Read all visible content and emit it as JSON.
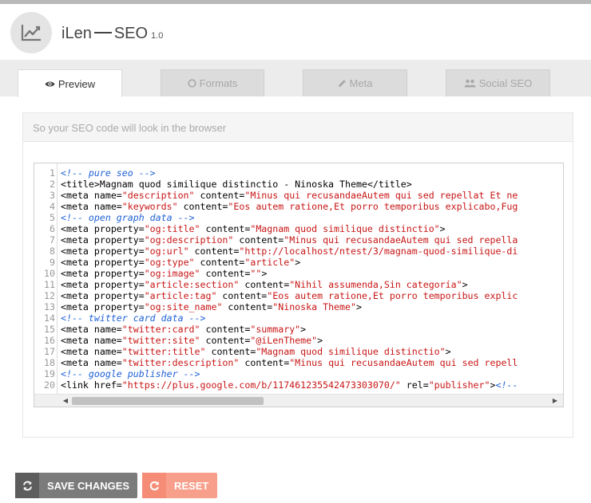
{
  "app": {
    "logo_icon": "trend-chart-icon",
    "name_part1": "iLen",
    "name_part2": "SEO",
    "version": "1.0"
  },
  "tabs": [
    {
      "label": "Preview",
      "icon": "eye-icon",
      "active": true
    },
    {
      "label": "Formats",
      "icon": "circle-icon",
      "active": false
    },
    {
      "label": "Meta",
      "icon": "pencil-icon",
      "active": false
    },
    {
      "label": "Social SEO",
      "icon": "users-icon",
      "active": false
    }
  ],
  "panel": {
    "heading": "So your SEO code will look in the browser"
  },
  "code": [
    {
      "n": "1",
      "parts": [
        [
          "cm",
          "<!-- pure seo -->"
        ]
      ]
    },
    {
      "n": "2",
      "parts": [
        [
          "tg",
          "<title>Magnam quod similique distinctio - Ninoska Theme</title>"
        ]
      ]
    },
    {
      "n": "3",
      "parts": [
        [
          "tg",
          "<meta name="
        ],
        [
          "str",
          "\"description\""
        ],
        [
          "tg",
          " content="
        ],
        [
          "str",
          "\"Minus qui recusandaeAutem qui sed repellat Et ne"
        ]
      ]
    },
    {
      "n": "4",
      "parts": [
        [
          "tg",
          "<meta name="
        ],
        [
          "str",
          "\"keywords\""
        ],
        [
          "tg",
          " content="
        ],
        [
          "str",
          "\"Eos autem ratione,Et porro temporibus explicabo,Fug"
        ]
      ]
    },
    {
      "n": "5",
      "parts": [
        [
          "cm",
          "<!-- open graph data -->"
        ]
      ]
    },
    {
      "n": "6",
      "parts": [
        [
          "tg",
          "<meta property="
        ],
        [
          "str",
          "\"og:title\""
        ],
        [
          "tg",
          " content="
        ],
        [
          "str",
          "\"Magnam quod similique distinctio\""
        ],
        [
          "tg",
          ">"
        ]
      ]
    },
    {
      "n": "7",
      "parts": [
        [
          "tg",
          "<meta property="
        ],
        [
          "str",
          "\"og:description\""
        ],
        [
          "tg",
          " content="
        ],
        [
          "str",
          "\"Minus qui recusandaeAutem qui sed repella"
        ]
      ]
    },
    {
      "n": "8",
      "parts": [
        [
          "tg",
          "<meta property="
        ],
        [
          "str",
          "\"og:url\""
        ],
        [
          "tg",
          " content="
        ],
        [
          "str",
          "\"http://localhost/ntest/3/magnam-quod-similique-di"
        ]
      ]
    },
    {
      "n": "9",
      "parts": [
        [
          "tg",
          "<meta property="
        ],
        [
          "str",
          "\"og:type\""
        ],
        [
          "tg",
          " content="
        ],
        [
          "str",
          "\"article\""
        ],
        [
          "tg",
          ">"
        ]
      ]
    },
    {
      "n": "10",
      "parts": [
        [
          "tg",
          "<meta property="
        ],
        [
          "str",
          "\"og:image\""
        ],
        [
          "tg",
          " content="
        ],
        [
          "str",
          "\"\""
        ],
        [
          "tg",
          ">"
        ]
      ]
    },
    {
      "n": "11",
      "parts": [
        [
          "tg",
          "<meta property="
        ],
        [
          "str",
          "\"article:section\""
        ],
        [
          "tg",
          " content="
        ],
        [
          "str",
          "\"Nihil assumenda,Sin categoría\""
        ],
        [
          "tg",
          ">"
        ]
      ]
    },
    {
      "n": "12",
      "parts": [
        [
          "tg",
          "<meta property="
        ],
        [
          "str",
          "\"article:tag\""
        ],
        [
          "tg",
          " content="
        ],
        [
          "str",
          "\"Eos autem ratione,Et porro temporibus explic"
        ]
      ]
    },
    {
      "n": "13",
      "parts": [
        [
          "tg",
          "<meta property="
        ],
        [
          "str",
          "\"og:site_name\""
        ],
        [
          "tg",
          " content="
        ],
        [
          "str",
          "\"Ninoska Theme\""
        ],
        [
          "tg",
          ">"
        ]
      ]
    },
    {
      "n": "14",
      "parts": [
        [
          "cm",
          "<!-- twitter card data -->"
        ]
      ]
    },
    {
      "n": "15",
      "parts": [
        [
          "tg",
          "<meta name="
        ],
        [
          "str",
          "\"twitter:card\""
        ],
        [
          "tg",
          " content="
        ],
        [
          "str",
          "\"summary\""
        ],
        [
          "tg",
          ">"
        ]
      ]
    },
    {
      "n": "16",
      "parts": [
        [
          "tg",
          "<meta name="
        ],
        [
          "str",
          "\"twitter:site\""
        ],
        [
          "tg",
          " content="
        ],
        [
          "str",
          "\"@iLenTheme\""
        ],
        [
          "tg",
          ">"
        ]
      ]
    },
    {
      "n": "17",
      "parts": [
        [
          "tg",
          "<meta name="
        ],
        [
          "str",
          "\"twitter:title\""
        ],
        [
          "tg",
          " content="
        ],
        [
          "str",
          "\"Magnam quod similique distinctio\""
        ],
        [
          "tg",
          ">"
        ]
      ]
    },
    {
      "n": "18",
      "parts": [
        [
          "tg",
          "<meta name="
        ],
        [
          "str",
          "\"twitter:description\""
        ],
        [
          "tg",
          " content="
        ],
        [
          "str",
          "\"Minus qui recusandaeAutem qui sed repell"
        ]
      ]
    },
    {
      "n": "19",
      "parts": [
        [
          "cm",
          "<!-- google publisher -->"
        ]
      ]
    },
    {
      "n": "20",
      "parts": [
        [
          "tg",
          "<link href="
        ],
        [
          "str",
          "\"https://plus.google.com/b/117461235542473303070/\""
        ],
        [
          "tg",
          " rel="
        ],
        [
          "str",
          "\"publisher\""
        ],
        [
          "tg",
          ">"
        ],
        [
          "cm",
          "<!--"
        ]
      ]
    }
  ],
  "buttons": {
    "save_label": "SAVE CHANGES",
    "save_icon": "refresh-icon",
    "reset_label": "RESET",
    "reset_icon": "undo-icon"
  },
  "colors": {
    "comment": "#1e61d6",
    "string": "#c81616",
    "save_bg": "#7b7b7b",
    "reset_bg": "#f79f8b"
  }
}
